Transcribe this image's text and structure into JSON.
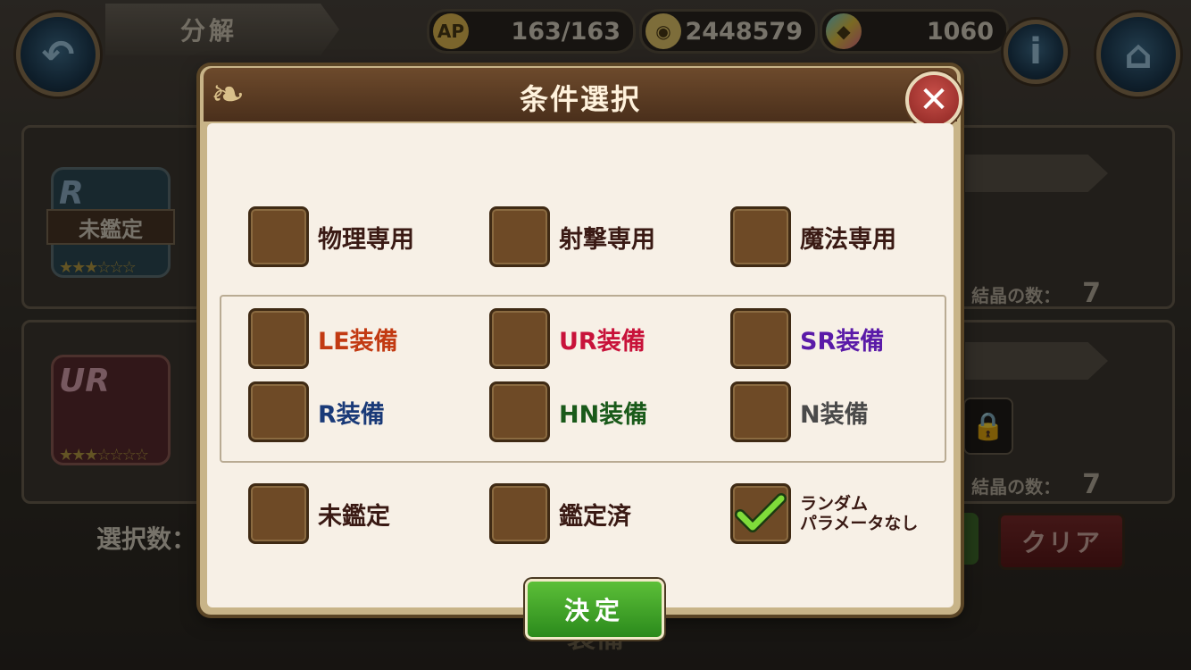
{
  "header": {
    "screen_title": "分解",
    "ap": "163/163",
    "ap_icon": "AP",
    "coins": "2448579",
    "gems": "1060"
  },
  "background": {
    "card1": {
      "rarity": "R",
      "status": "未鑑定",
      "crystal_label": "結晶の数：",
      "crystal_count": "7"
    },
    "card2": {
      "rarity": "UR",
      "crystal_label": "結晶の数：",
      "crystal_count": "7"
    },
    "selected_count_label": "選択数：",
    "clear_button": "クリア",
    "bottom_tab": "装備"
  },
  "modal": {
    "title": "条件選択",
    "options": {
      "physical": {
        "label": "物理専用",
        "checked": false
      },
      "shooting": {
        "label": "射撃専用",
        "checked": false
      },
      "magic": {
        "label": "魔法専用",
        "checked": false
      },
      "le": {
        "label": "LE装備",
        "checked": false,
        "color": "#c23a12"
      },
      "ur": {
        "label": "UR装備",
        "checked": false,
        "color": "#c8123a"
      },
      "sr": {
        "label": "SR装備",
        "checked": false,
        "color": "#5a1aa8"
      },
      "r": {
        "label": "R装備",
        "checked": false,
        "color": "#1a3a78"
      },
      "hn": {
        "label": "HN装備",
        "checked": false,
        "color": "#1a5a1a"
      },
      "n": {
        "label": "N装備",
        "checked": false,
        "color": "#4a4a4a"
      },
      "unappraised": {
        "label": "未鑑定",
        "checked": false
      },
      "appraised": {
        "label": "鑑定済",
        "checked": false
      },
      "random_none": {
        "label": "ランダムパラメータなし",
        "label_line1": "ランダム",
        "label_line2": "パラメータなし",
        "checked": true
      }
    },
    "decide_button": "決定"
  }
}
